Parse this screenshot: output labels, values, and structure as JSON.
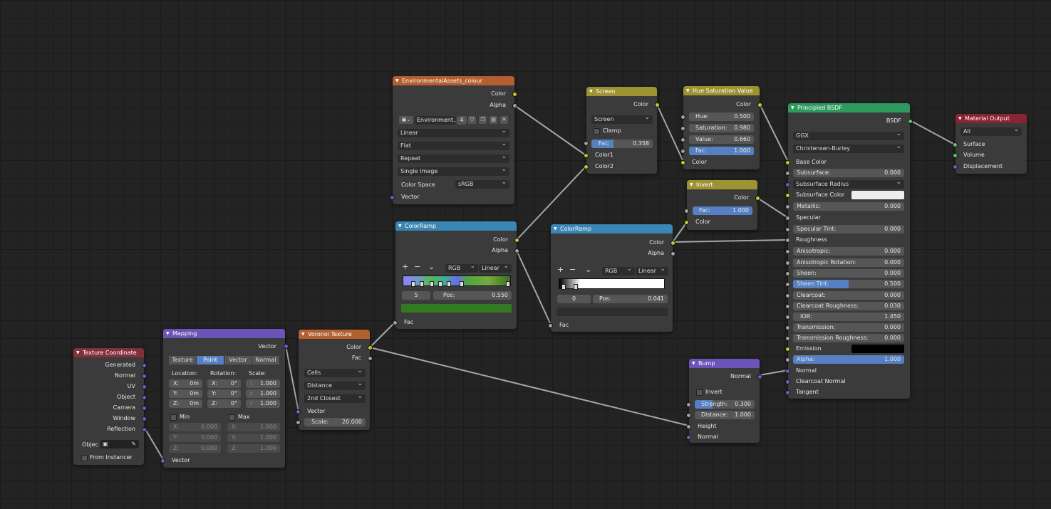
{
  "nodes": {
    "tex_coord": {
      "title": "Texture Coordinate",
      "outputs": [
        "Generated",
        "Normal",
        "UV",
        "Object",
        "Camera",
        "Window",
        "Reflection"
      ],
      "object_label": "Objec",
      "from_instancer": "From Instancer",
      "input_vector": "Vector"
    },
    "mapping": {
      "title": "Mapping",
      "output_vector": "Vector",
      "types": [
        "Texture",
        "Point",
        "Vector",
        "Normal"
      ],
      "active_type": "Point",
      "col_location": "Location:",
      "col_rotation": "Rotation:",
      "col_scale": "Scale:",
      "loc": [
        "X:",
        "0m",
        "Y:",
        "0m",
        "Z:",
        "0m"
      ],
      "rot": [
        "X:",
        "0°",
        "Y:",
        "0°",
        "Z:",
        "0°"
      ],
      "scale": [
        ":",
        "1.000",
        ":",
        "1.000",
        ":",
        "1.000"
      ],
      "min_label": "Min",
      "max_label": "Max",
      "min_vals": [
        "X:",
        "0.000",
        "Y:",
        "0.000",
        "Z:",
        "0.000"
      ],
      "max_vals": [
        "X:",
        "1.000",
        "Y:",
        "1.000",
        "Z:",
        "1.000"
      ],
      "input_vector": "Vector"
    },
    "voronoi": {
      "title": "Voronoi Texture",
      "out_color": "Color",
      "out_fac": "Fac",
      "dd1": "Cells",
      "dd2": "Distance",
      "dd3": "2nd Closest",
      "in_vector": "Vector",
      "scale_label": "Scale:",
      "scale_value": "20.000"
    },
    "env": {
      "title": "EnvironmentalAssets_colour",
      "out_color": "Color",
      "out_alpha": "Alpha",
      "image_name": "Environment...",
      "users": "4",
      "interp": "Linear",
      "proj": "Flat",
      "ext": "Repeat",
      "source": "Single Image",
      "cs_label": "Color Space",
      "cs_value": "sRGB",
      "in_vector": "Vector"
    },
    "ramp1": {
      "title": "ColorRamp",
      "out_color": "Color",
      "out_alpha": "Alpha",
      "mode": "RGB",
      "interp": "Linear",
      "index": "5",
      "pos_label": "Pos:",
      "pos_value": "0.550",
      "swatch": "#347a22",
      "in_fac": "Fac"
    },
    "ramp2": {
      "title": "ColorRamp",
      "out_color": "Color",
      "out_alpha": "Alpha",
      "mode": "RGB",
      "interp": "Linear",
      "index": "0",
      "pos_label": "Pos:",
      "pos_value": "0.041",
      "in_fac": "Fac"
    },
    "screen": {
      "title": "Screen",
      "out_color": "Color",
      "mode": "Screen",
      "clamp": "Clamp",
      "fac_label": "Fac:",
      "fac_value": "0.358",
      "fac": 0.358,
      "in_color1": "Color1",
      "in_color2": "Color2"
    },
    "hsv": {
      "title": "Hue Saturation Value",
      "out_color": "Color",
      "hue_label": "Hue:",
      "hue_value": "0.500",
      "sat_label": "Saturation:",
      "sat_value": "0.980",
      "val_label": "Value:",
      "val_value": "0.660",
      "fac_label": "Fac:",
      "fac_value": "1.000",
      "in_color": "Color"
    },
    "invert": {
      "title": "Invert",
      "out_color": "Color",
      "fac_label": "Fac:",
      "fac_value": "1.000",
      "in_color": "Color"
    },
    "bump": {
      "title": "Bump",
      "out_normal": "Normal",
      "invert": "Invert",
      "strength_label": "Strength:",
      "strength_value": "0.300",
      "strength": 0.3,
      "distance_label": "Distance:",
      "distance_value": "1.000",
      "in_height": "Height",
      "in_normal": "Normal"
    },
    "bsdf": {
      "title": "Principled BSDF",
      "out": "BSDF",
      "dist": "GGX",
      "sss": "Christensen-Burley",
      "base_color": "Base Color",
      "subsurface_label": "Subsurface:",
      "subsurface_value": "0.000",
      "subsurface_radius": "Subsurface Radius",
      "subsurface_color": "Subsurface Color",
      "metallic_label": "Metallic:",
      "metallic_value": "0.000",
      "specular": "Specular",
      "spec_tint_label": "Specular Tint:",
      "spec_tint_value": "0.000",
      "roughness": "Roughness",
      "aniso_label": "Anisotropic:",
      "aniso_value": "0.000",
      "aniso_rot_label": "Anisotropic Rotation:",
      "aniso_rot_value": "0.000",
      "sheen_label": "Sheen:",
      "sheen_value": "0.000",
      "sheen_tint_label": "Sheen Tint:",
      "sheen_tint_value": "0.500",
      "sheen_tint": 0.5,
      "clearcoat_label": "Clearcoat:",
      "clearcoat_value": "0.000",
      "cc_rough_label": "Clearcoat Roughness:",
      "cc_rough_value": "0.030",
      "ior_label": "IOR:",
      "ior_value": "1.450",
      "trans_label": "Transmission:",
      "trans_value": "0.000",
      "trans_rough_label": "Transmission Roughness:",
      "trans_rough_value": "0.000",
      "emission": "Emission",
      "alpha_label": "Alpha:",
      "alpha_value": "1.000",
      "alpha": 1.0,
      "normal": "Normal",
      "cc_normal": "Clearcoat Normal",
      "tangent": "Tangent"
    },
    "output": {
      "title": "Material Output",
      "target": "All",
      "surface": "Surface",
      "volume": "Volume",
      "displacement": "Displacement"
    }
  },
  "colors": {
    "input_header": "#84303b",
    "texture_header": "#b35f30",
    "color_header": "#9e9333",
    "converter_header": "#3a86b5",
    "vector_header": "#6c53b8",
    "shader_header": "#2f9a5e",
    "output_header": "#8a2332",
    "accent": "#5680c2"
  }
}
